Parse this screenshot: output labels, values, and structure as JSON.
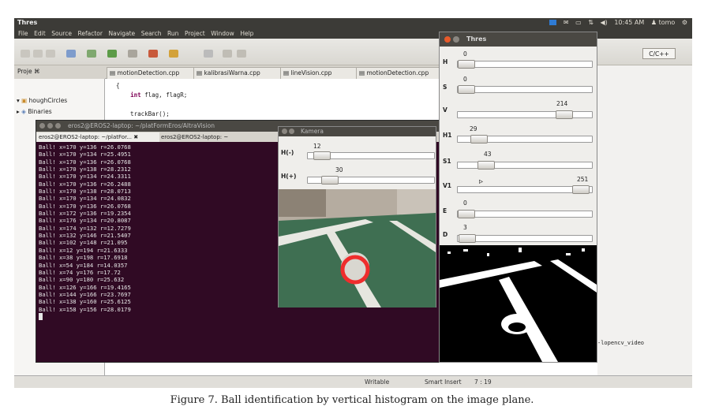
{
  "topbar": {
    "app_title": "Thres",
    "time": "10:45 AM",
    "user": "tomo"
  },
  "menubar": [
    "File",
    "Edit",
    "Source",
    "Refactor",
    "Navigate",
    "Search",
    "Run",
    "Project",
    "Window",
    "Help"
  ],
  "perspective": "C/C++",
  "project_explorer": {
    "tab_label": "Proje ⌘",
    "items": [
      "houghCircles",
      "Binaries"
    ]
  },
  "editor": {
    "tabs": [
      "motionDetection.cpp",
      "kalibrasiWarna.cpp",
      "lineVision.cpp",
      "motionDetection.cpp"
    ],
    "code_lines": [
      {
        "pre": "{",
        "kw": "",
        "post": ""
      },
      {
        "pre": "    ",
        "kw": "int",
        "post": " flag, flagR;"
      },
      {
        "pre": "",
        "kw": "",
        "post": ""
      },
      {
        "pre": "    trackBar();",
        "kw": "",
        "post": ""
      }
    ]
  },
  "terminal": {
    "title": "eros2@EROS2-laptop: ~/platFormEros/AltraVision",
    "tabs": [
      "eros2@EROS2-laptop: ~/platFor...",
      "eros2@EROS2-laptop: ~"
    ],
    "lines": [
      "Ball! x=170 y=136 r=26.0768",
      "Ball! x=170 y=134 r=25.4951",
      "Ball! x=170 y=136 r=26.0768",
      "Ball! x=170 y=138 r=28.2312",
      "Ball! x=170 y=134 r=24.3311",
      "Ball! x=170 y=136 r=26.2488",
      "Ball! x=170 y=138 r=28.0713",
      "Ball! x=170 y=134 r=24.0832",
      "Ball! x=170 y=136 r=26.0768",
      "Ball! x=172 y=136 r=19.2354",
      "Ball! x=176 y=134 r=20.8087",
      "Ball! x=174 y=132 r=12.7279",
      "Ball! x=132 y=146 r=21.5407",
      "Ball! x=102 y=148 r=21.095",
      "Ball! x=12 y=194 r=21.6333",
      "Ball! x=38 y=198 r=17.6918",
      "Ball! x=54 y=184 r=14.0357",
      "Ball! x=74 y=176 r=17.72",
      "Ball! x=90 y=180 r=25.632",
      "Ball! x=126 y=166 r=19.4165",
      "Ball! x=144 y=166 r=23.7697",
      "Ball! x=138 y=160 r=25.6125",
      "Ball! x=158 y=156 r=28.0179"
    ]
  },
  "kamera": {
    "title": "Kamera",
    "sliders": [
      {
        "label": "H(-)",
        "value": "12",
        "level": 0.05
      },
      {
        "label": "H(+)",
        "value": "30",
        "level": 0.12
      }
    ]
  },
  "thres": {
    "title": "Thres",
    "sliders": [
      {
        "label": "H",
        "value": "0",
        "level": 0.0
      },
      {
        "label": "S",
        "value": "0",
        "level": 0.0
      },
      {
        "label": "V",
        "value": "214",
        "level": 0.84
      },
      {
        "label": "H1",
        "value": "29",
        "level": 0.11
      },
      {
        "label": "S1",
        "value": "43",
        "level": 0.17
      },
      {
        "label": "V1",
        "value": "251",
        "level": 0.98
      },
      {
        "label": "E",
        "value": "0",
        "level": 0.0
      },
      {
        "label": "D",
        "value": "3",
        "level": 0.01
      }
    ]
  },
  "console": {
    "text": "-lopencv_video"
  },
  "statusbar": {
    "mode": "Writable",
    "insert": "Smart Insert",
    "position": "7 : 19"
  },
  "caption": "Figure 7. Ball identification by vertical histogram on the image plane."
}
